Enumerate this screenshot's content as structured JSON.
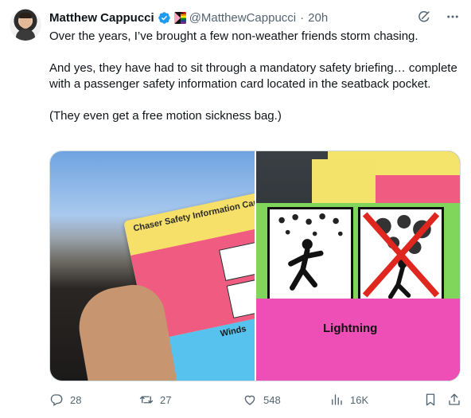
{
  "author": {
    "name": "Matthew Cappucci",
    "handle": "@MatthewCappucci",
    "separator": "·",
    "time": "20h"
  },
  "icons": {
    "verified": "verified-badge-icon",
    "flag": "pride-flag-icon",
    "grok": "grok-icon",
    "more": "more-icon",
    "reply": "reply-icon",
    "retweet": "retweet-icon",
    "like": "heart-icon",
    "views": "views-bar-chart-icon",
    "bookmark": "bookmark-icon",
    "share": "share-icon"
  },
  "colors": {
    "verified_blue": "#1d9bf0",
    "secondary_text": "#536471"
  },
  "tweet": {
    "line1": "Over the years, I’ve brought a few non-weather friends storm chasing.",
    "line2": "And yes, they have had to sit through a mandatory safety briefing… complete with a passenger safety information card located in the seatback pocket.",
    "line3": "(They even get a free motion sickness bag.)"
  },
  "media": {
    "left_card_title": "Chaser Safety Information Card",
    "left_card_section": "Winds",
    "right_card_section": "Lightning"
  },
  "stats": {
    "replies": "28",
    "retweets": "27",
    "likes": "548",
    "views": "16K"
  }
}
